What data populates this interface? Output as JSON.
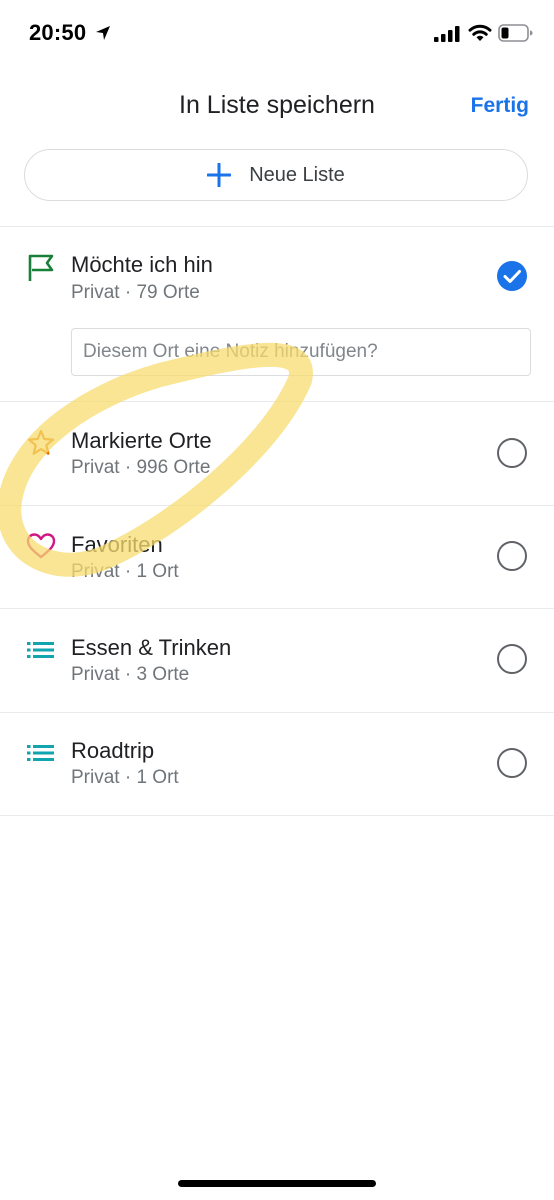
{
  "status_bar": {
    "time": "20:50",
    "icons": [
      "location-arrow-icon",
      "cellular-signal-icon",
      "wifi-icon",
      "battery-icon"
    ]
  },
  "header": {
    "title": "In Liste speichern",
    "done_label": "Fertig"
  },
  "new_list": {
    "label": "Neue Liste",
    "icon": "plus-icon"
  },
  "note": {
    "placeholder": "Diesem Ort eine Notiz hinzufügen?"
  },
  "lists": [
    {
      "title": "Möchte ich hin",
      "subtitle": "Privat · 79 Orte",
      "icon": "flag-icon",
      "selected": true
    },
    {
      "title": "Markierte Orte",
      "subtitle": "Privat · 996 Orte",
      "icon": "star-icon",
      "selected": false
    },
    {
      "title": "Favoriten",
      "subtitle": "Privat · 1 Ort",
      "icon": "heart-icon",
      "selected": false
    },
    {
      "title": "Essen & Trinken",
      "subtitle": "Privat · 3 Orte",
      "icon": "list-icon",
      "selected": false
    },
    {
      "title": "Roadtrip",
      "subtitle": "Privat · 1 Ort",
      "icon": "list-icon",
      "selected": false
    }
  ],
  "colors": {
    "accent": "#1a73e8",
    "flag": "#188038",
    "star": "#e37400",
    "heart": "#d01884",
    "list": "#12a4af",
    "highlight": "#f7dc6f"
  }
}
